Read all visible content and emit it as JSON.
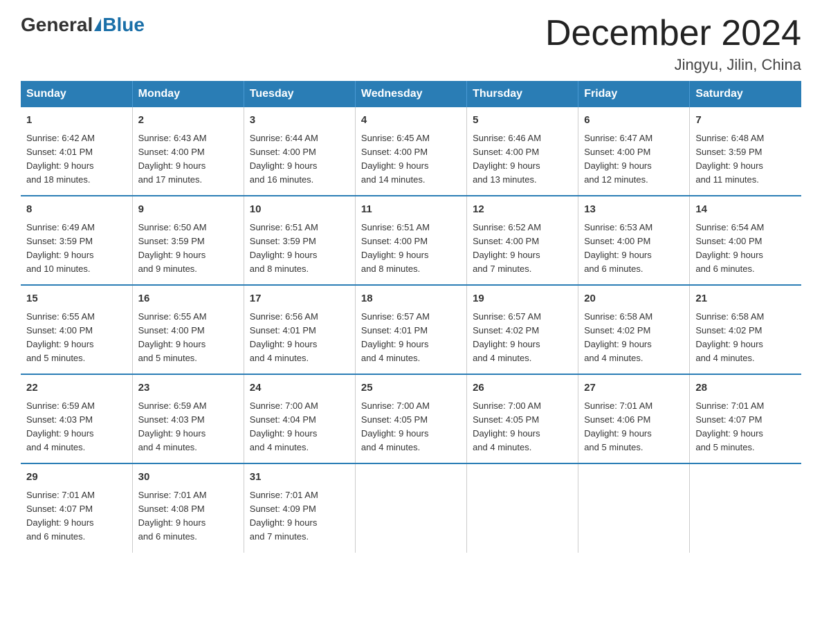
{
  "logo": {
    "general": "General",
    "blue": "Blue"
  },
  "title": "December 2024",
  "subtitle": "Jingyu, Jilin, China",
  "days_of_week": [
    "Sunday",
    "Monday",
    "Tuesday",
    "Wednesday",
    "Thursday",
    "Friday",
    "Saturday"
  ],
  "weeks": [
    [
      {
        "day": "1",
        "sunrise": "6:42 AM",
        "sunset": "4:01 PM",
        "daylight": "9 hours and 18 minutes."
      },
      {
        "day": "2",
        "sunrise": "6:43 AM",
        "sunset": "4:00 PM",
        "daylight": "9 hours and 17 minutes."
      },
      {
        "day": "3",
        "sunrise": "6:44 AM",
        "sunset": "4:00 PM",
        "daylight": "9 hours and 16 minutes."
      },
      {
        "day": "4",
        "sunrise": "6:45 AM",
        "sunset": "4:00 PM",
        "daylight": "9 hours and 14 minutes."
      },
      {
        "day": "5",
        "sunrise": "6:46 AM",
        "sunset": "4:00 PM",
        "daylight": "9 hours and 13 minutes."
      },
      {
        "day": "6",
        "sunrise": "6:47 AM",
        "sunset": "4:00 PM",
        "daylight": "9 hours and 12 minutes."
      },
      {
        "day": "7",
        "sunrise": "6:48 AM",
        "sunset": "3:59 PM",
        "daylight": "9 hours and 11 minutes."
      }
    ],
    [
      {
        "day": "8",
        "sunrise": "6:49 AM",
        "sunset": "3:59 PM",
        "daylight": "9 hours and 10 minutes."
      },
      {
        "day": "9",
        "sunrise": "6:50 AM",
        "sunset": "3:59 PM",
        "daylight": "9 hours and 9 minutes."
      },
      {
        "day": "10",
        "sunrise": "6:51 AM",
        "sunset": "3:59 PM",
        "daylight": "9 hours and 8 minutes."
      },
      {
        "day": "11",
        "sunrise": "6:51 AM",
        "sunset": "4:00 PM",
        "daylight": "9 hours and 8 minutes."
      },
      {
        "day": "12",
        "sunrise": "6:52 AM",
        "sunset": "4:00 PM",
        "daylight": "9 hours and 7 minutes."
      },
      {
        "day": "13",
        "sunrise": "6:53 AM",
        "sunset": "4:00 PM",
        "daylight": "9 hours and 6 minutes."
      },
      {
        "day": "14",
        "sunrise": "6:54 AM",
        "sunset": "4:00 PM",
        "daylight": "9 hours and 6 minutes."
      }
    ],
    [
      {
        "day": "15",
        "sunrise": "6:55 AM",
        "sunset": "4:00 PM",
        "daylight": "9 hours and 5 minutes."
      },
      {
        "day": "16",
        "sunrise": "6:55 AM",
        "sunset": "4:00 PM",
        "daylight": "9 hours and 5 minutes."
      },
      {
        "day": "17",
        "sunrise": "6:56 AM",
        "sunset": "4:01 PM",
        "daylight": "9 hours and 4 minutes."
      },
      {
        "day": "18",
        "sunrise": "6:57 AM",
        "sunset": "4:01 PM",
        "daylight": "9 hours and 4 minutes."
      },
      {
        "day": "19",
        "sunrise": "6:57 AM",
        "sunset": "4:02 PM",
        "daylight": "9 hours and 4 minutes."
      },
      {
        "day": "20",
        "sunrise": "6:58 AM",
        "sunset": "4:02 PM",
        "daylight": "9 hours and 4 minutes."
      },
      {
        "day": "21",
        "sunrise": "6:58 AM",
        "sunset": "4:02 PM",
        "daylight": "9 hours and 4 minutes."
      }
    ],
    [
      {
        "day": "22",
        "sunrise": "6:59 AM",
        "sunset": "4:03 PM",
        "daylight": "9 hours and 4 minutes."
      },
      {
        "day": "23",
        "sunrise": "6:59 AM",
        "sunset": "4:03 PM",
        "daylight": "9 hours and 4 minutes."
      },
      {
        "day": "24",
        "sunrise": "7:00 AM",
        "sunset": "4:04 PM",
        "daylight": "9 hours and 4 minutes."
      },
      {
        "day": "25",
        "sunrise": "7:00 AM",
        "sunset": "4:05 PM",
        "daylight": "9 hours and 4 minutes."
      },
      {
        "day": "26",
        "sunrise": "7:00 AM",
        "sunset": "4:05 PM",
        "daylight": "9 hours and 4 minutes."
      },
      {
        "day": "27",
        "sunrise": "7:01 AM",
        "sunset": "4:06 PM",
        "daylight": "9 hours and 5 minutes."
      },
      {
        "day": "28",
        "sunrise": "7:01 AM",
        "sunset": "4:07 PM",
        "daylight": "9 hours and 5 minutes."
      }
    ],
    [
      {
        "day": "29",
        "sunrise": "7:01 AM",
        "sunset": "4:07 PM",
        "daylight": "9 hours and 6 minutes."
      },
      {
        "day": "30",
        "sunrise": "7:01 AM",
        "sunset": "4:08 PM",
        "daylight": "9 hours and 6 minutes."
      },
      {
        "day": "31",
        "sunrise": "7:01 AM",
        "sunset": "4:09 PM",
        "daylight": "9 hours and 7 minutes."
      },
      null,
      null,
      null,
      null
    ]
  ]
}
